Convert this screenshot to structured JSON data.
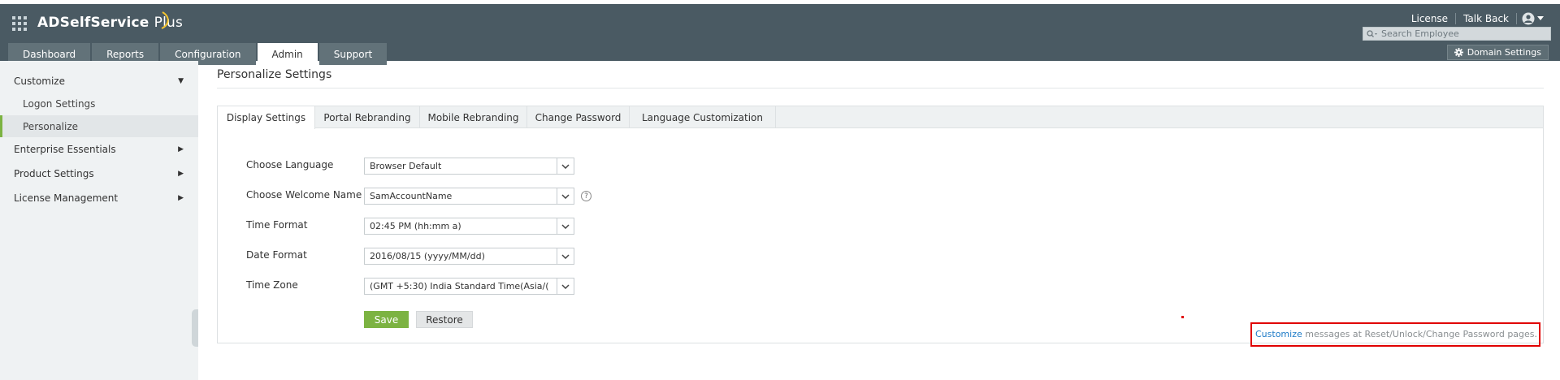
{
  "header": {
    "app_name": "ADSelfService",
    "app_name_suffix": "Plus",
    "links": [
      "License",
      "Talk Back"
    ],
    "search_placeholder": "Search Employee",
    "domain_settings_label": "Domain Settings",
    "brand_color": "#4a5a63"
  },
  "nav": {
    "tabs": [
      "Dashboard",
      "Reports",
      "Configuration",
      "Admin",
      "Support"
    ],
    "active_tab": "Admin"
  },
  "sidebar": {
    "items": [
      {
        "label": "Customize",
        "expanded": true
      },
      {
        "label": "Logon Settings",
        "sub": true
      },
      {
        "label": "Personalize",
        "sub": true,
        "selected": true
      },
      {
        "label": "Enterprise Essentials"
      },
      {
        "label": "Product Settings"
      },
      {
        "label": "License Management"
      }
    ],
    "accent": "#7cb342"
  },
  "main": {
    "title": "Personalize Settings",
    "tabs": [
      "Display Settings",
      "Portal Rebranding",
      "Mobile Rebranding",
      "Change Password",
      "Language Customization"
    ],
    "active_tab": "Display Settings",
    "form": {
      "language_label": "Choose Language",
      "language_value": "Browser Default",
      "welcome_label": "Choose Welcome Name",
      "welcome_value": "SamAccountName",
      "time_label": "Time Format",
      "time_value": "02:45 PM (hh:mm a)",
      "date_label": "Date Format",
      "date_value": "2016/08/15 (yyyy/MM/dd)",
      "timezone_label": "Time Zone",
      "timezone_value": "(GMT +5:30) India Standard Time(Asia/("
    },
    "save_label": "Save",
    "restore_label": "Restore",
    "customize_link": "Customize",
    "customize_text": " messages at Reset/Unlock/Change Password pages."
  }
}
